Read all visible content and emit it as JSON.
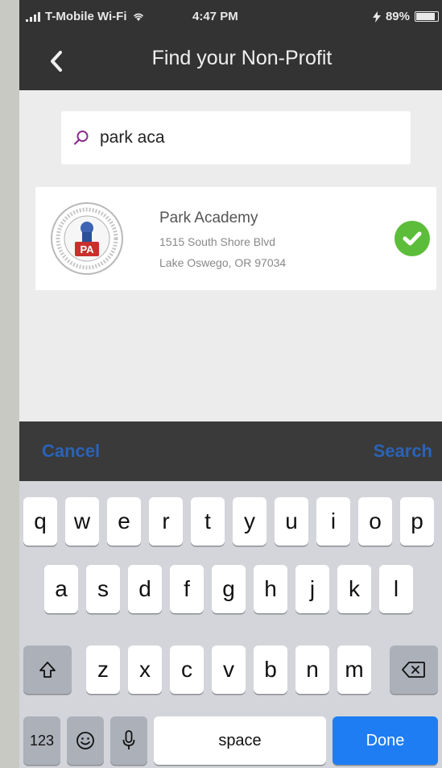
{
  "status_bar": {
    "carrier": "T-Mobile Wi-Fi",
    "time": "4:47 PM",
    "battery": "89%",
    "battery_level": 0.89
  },
  "nav": {
    "title": "Find your Non-Profit",
    "back_icon": "chevron-left-icon"
  },
  "search": {
    "value": "park aca",
    "icon": "search-icon"
  },
  "result": {
    "name": "Park Academy",
    "address_line1": "1515 South Shore Blvd",
    "address_line2": "Lake Oswego, OR 97034",
    "selected_icon": "checkmark-circle-icon",
    "seal_icon": "school-seal-icon"
  },
  "accessory_bar": {
    "cancel": "Cancel",
    "search": "Search"
  },
  "keyboard": {
    "row1": [
      "q",
      "w",
      "e",
      "r",
      "t",
      "y",
      "u",
      "i",
      "o",
      "p"
    ],
    "row2": [
      "a",
      "s",
      "d",
      "f",
      "g",
      "h",
      "j",
      "k",
      "l"
    ],
    "row3": [
      "z",
      "x",
      "c",
      "v",
      "b",
      "n",
      "m"
    ],
    "numbers": "123",
    "space": "space",
    "done": "Done"
  },
  "colors": {
    "nav_bg": "#333333",
    "accent_blue": "#1e7df3",
    "check_green": "#5cbd3a"
  }
}
